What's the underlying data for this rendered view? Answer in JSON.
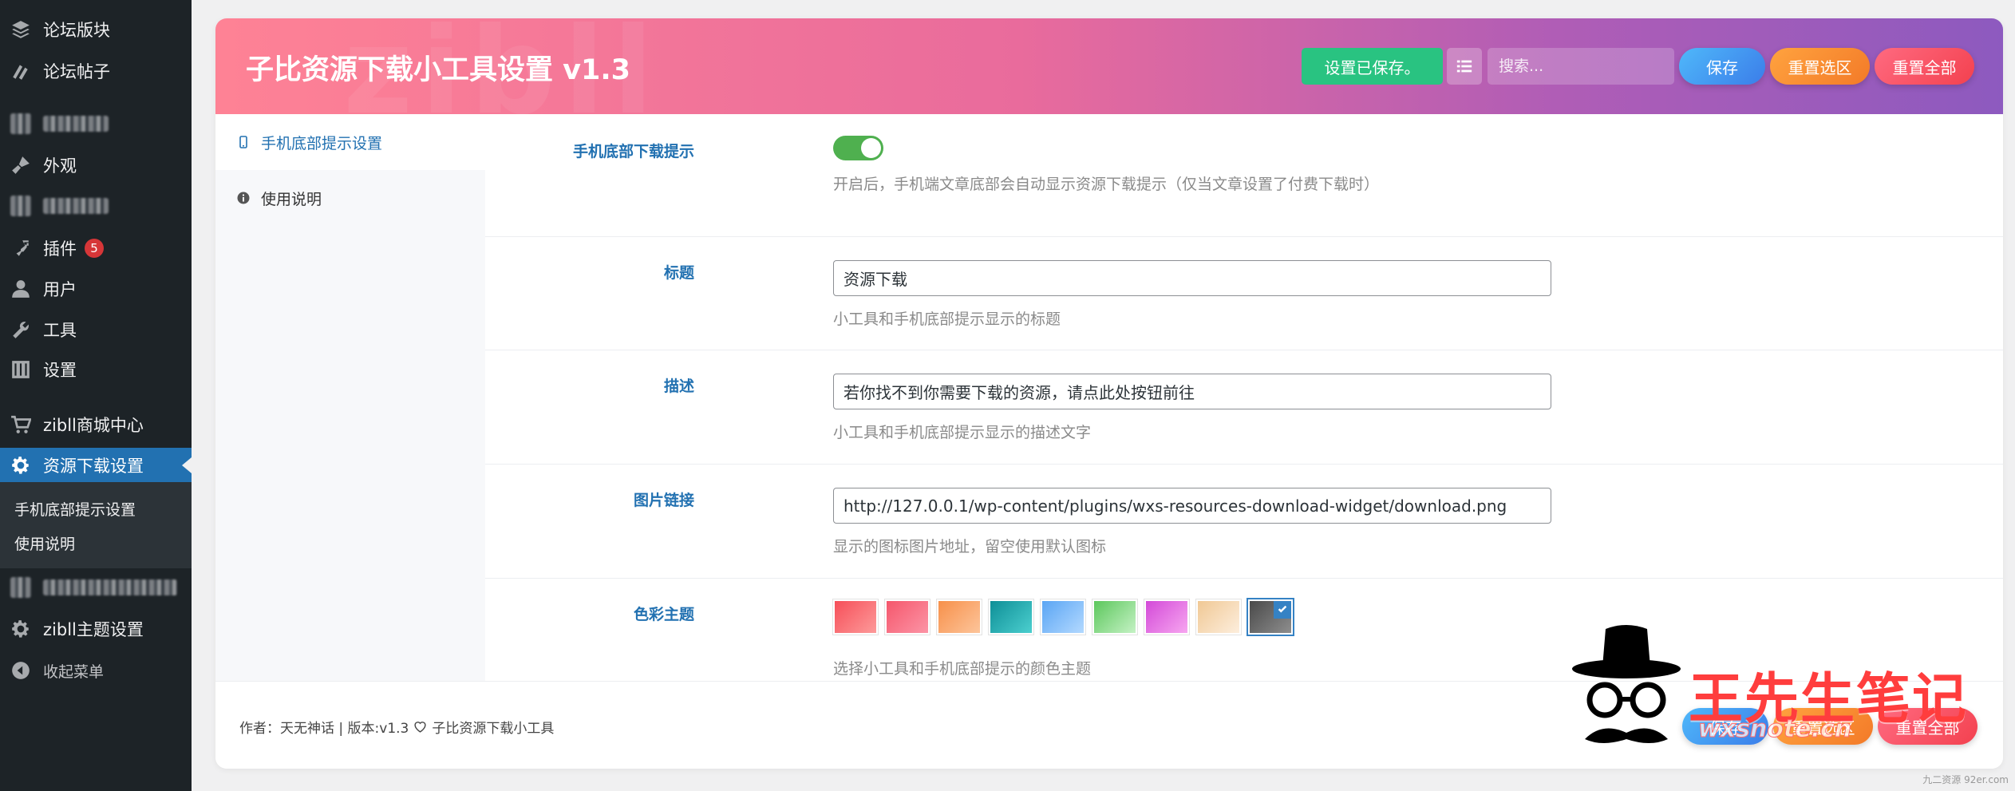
{
  "sidebar": {
    "items": [
      {
        "id": "forum-sections",
        "label": "论坛版块",
        "icon": "stack-icon"
      },
      {
        "id": "forum-posts",
        "label": "论坛帖子",
        "icon": "posts-icon"
      },
      {
        "id": "blurred-1",
        "label": "",
        "icon": "blurred-icon"
      },
      {
        "id": "appearance",
        "label": "外观",
        "icon": "brush-icon"
      },
      {
        "id": "blurred-2",
        "label": "",
        "icon": "blurred-icon"
      },
      {
        "id": "plugins",
        "label": "插件",
        "icon": "plugin-icon",
        "badge": "5"
      },
      {
        "id": "users",
        "label": "用户",
        "icon": "user-icon"
      },
      {
        "id": "tools",
        "label": "工具",
        "icon": "wrench-icon"
      },
      {
        "id": "settings",
        "label": "设置",
        "icon": "settings-sliders-icon"
      },
      {
        "id": "zibll-shop",
        "label": "zibll商城中心",
        "icon": "cart-icon"
      },
      {
        "id": "resource-download-settings",
        "label": "资源下载设置",
        "icon": "gear-icon"
      },
      {
        "id": "blurred-3",
        "label": "",
        "icon": "blurred-icon"
      },
      {
        "id": "zibll-theme-settings",
        "label": "zibll主题设置",
        "icon": "gear-icon"
      },
      {
        "id": "collapse-menu",
        "label": "收起菜单",
        "icon": "collapse-icon"
      }
    ],
    "submenu": [
      "手机底部提示设置",
      "使用说明"
    ]
  },
  "header": {
    "title": "子比资源下载小工具设置 v1.3",
    "watermark": "zibll",
    "saved_notice": "设置已保存。",
    "search_placeholder": "搜索...",
    "save_label": "保存",
    "reset_section_label": "重置选区",
    "reset_all_label": "重置全部"
  },
  "nav": {
    "items": [
      {
        "label": "手机底部提示设置",
        "icon": "mobile-icon",
        "active": true
      },
      {
        "label": "使用说明",
        "icon": "info-icon",
        "active": false
      }
    ]
  },
  "fields": {
    "mobile_tip": {
      "label": "手机底部下载提示",
      "enabled": true,
      "desc": "开启后，手机端文章底部会自动显示资源下载提示（仅当文章设置了付费下载时）"
    },
    "title": {
      "label": "标题",
      "value": "资源下载",
      "desc": "小工具和手机底部提示显示的标题"
    },
    "description": {
      "label": "描述",
      "value": "若你找不到你需要下载的资源，请点此处按钮前往",
      "desc": "小工具和手机底部提示显示的描述文字"
    },
    "image_link": {
      "label": "图片链接",
      "value": "http://127.0.0.1/wp-content/plugins/wxs-resources-download-widget/download.png",
      "desc": "显示的图标图片地址，留空使用默认图标"
    },
    "color_theme": {
      "label": "色彩主题",
      "desc": "选择小工具和手机底部提示的颜色主题",
      "swatches": [
        {
          "from": "#f64f59",
          "to": "#fd9a9a"
        },
        {
          "from": "#f5576c",
          "to": "#fc94a6"
        },
        {
          "from": "#f7904a",
          "to": "#fdc59b"
        },
        {
          "from": "#0e8f97",
          "to": "#4ccfcf"
        },
        {
          "from": "#5aa5f4",
          "to": "#b3d9ff"
        },
        {
          "from": "#5cc75c",
          "to": "#c5f2c5"
        },
        {
          "from": "#d34ad8",
          "to": "#f7a6f0"
        },
        {
          "from": "#f0c894",
          "to": "#fdeedd"
        },
        {
          "from": "#4a4a4a",
          "to": "#8e8e8e"
        }
      ],
      "selected_index": 8
    }
  },
  "footer": {
    "author_prefix": "作者：天无神话 | 版本:v1.3",
    "plugin_name": "子比资源下载小工具",
    "save_label": "保存",
    "reset_section_label": "重置选区",
    "reset_all_label": "重置全部"
  },
  "watermark": {
    "title": "王先生笔记",
    "subtitle": "wxsnote.cn",
    "corner": "九二资源 92er.com"
  }
}
